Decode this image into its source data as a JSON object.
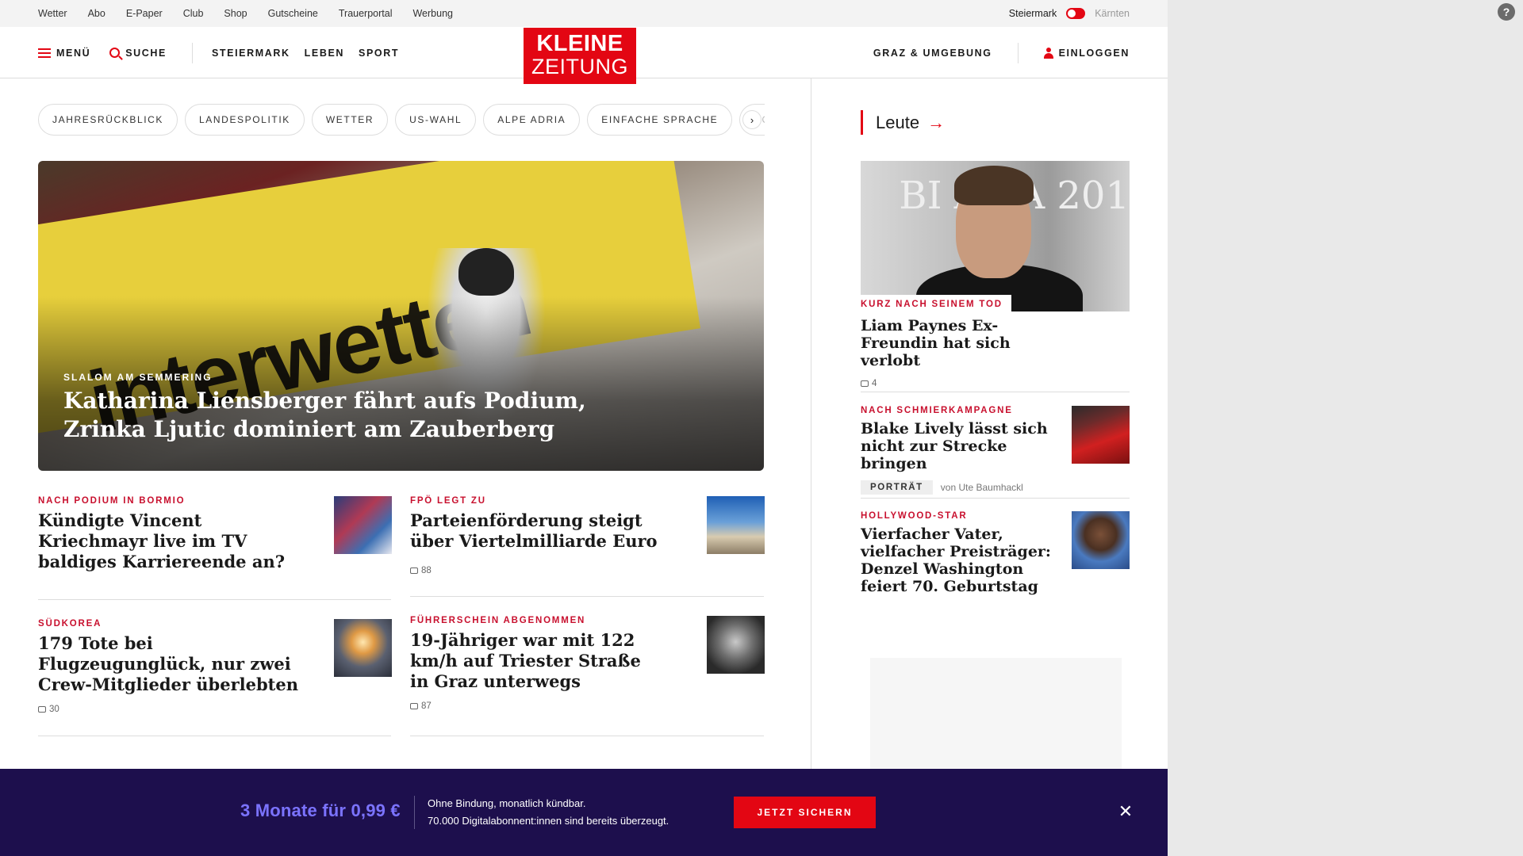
{
  "topbar": {
    "links": [
      "Wetter",
      "Abo",
      "E-Paper",
      "Club",
      "Shop",
      "Gutscheine",
      "Trauerportal",
      "Werbung"
    ],
    "region_active": "Steiermark",
    "region_inactive": "Kärnten"
  },
  "header": {
    "menu_label": "MENÜ",
    "search_label": "SUCHE",
    "nav": [
      "STEIERMARK",
      "LEBEN",
      "SPORT"
    ],
    "logo_line1": "KLEINE",
    "logo_line2": "ZEITUNG",
    "local_label": "GRAZ & UMGEBUNG",
    "login_label": "EINLOGGEN"
  },
  "chips": [
    "JAHRESRÜCKBLICK",
    "LANDESPOLITIK",
    "WETTER",
    "US-WAHL",
    "ALPE ADRIA",
    "EINFACHE SPRACHE",
    "DO"
  ],
  "hero": {
    "banner_text": "interwetten",
    "kicker": "SLALOM AM SEMMERING",
    "headline": "Katharina Liensberger fährt aufs Podium, Zrinka Ljutic dominiert am Zauberberg"
  },
  "articles": [
    {
      "kicker": "NACH PODIUM IN BORMIO",
      "title": "Kündigte Vincent Kriechmayr live im TV baldiges Karriereende an?",
      "comments": ""
    },
    {
      "kicker": "FPÖ LEGT ZU",
      "title": "Parteienförderung steigt über Viertelmilliarde Euro",
      "comments": "88"
    },
    {
      "kicker": "SÜDKOREA",
      "title": "179 Tote bei Flugzeugunglück, nur zwei Crew-Mitglieder überlebten",
      "comments": "30"
    },
    {
      "kicker": "FÜHRERSCHEIN ABGENOMMEN",
      "title": "19-Jähriger war mit 122 km/h auf Triester Straße in Graz unterwegs",
      "comments": "87"
    }
  ],
  "sidebar": {
    "section_title": "Leute",
    "arrow": "→",
    "image_text": "BI AWA 201",
    "items": [
      {
        "kicker": "KURZ NACH SEINEM TOD",
        "title": "Liam Paynes Ex-Freundin hat sich verlobt",
        "comments": "4"
      },
      {
        "kicker": "NACH SCHMIERKAMPAGNE",
        "title": "Blake Lively lässt sich nicht zur Strecke bringen",
        "tag": "PORTRÄT",
        "byline": "von Ute Baumhackl"
      },
      {
        "kicker": "HOLLYWOOD-STAR",
        "title": "Vierfacher Vater, vielfacher Preisträger: Denzel Washington feiert 70. Geburtstag"
      }
    ]
  },
  "promo": {
    "price": "3 Monate für 0,99 €",
    "line1": "Ohne Bindung, monatlich kündbar.",
    "line2": "70.000 Digitalabonnent:innen sind bereits überzeugt.",
    "cta": "JETZT SICHERN",
    "close": "✕"
  },
  "help_icon": "?",
  "colors": {
    "brand_red": "#e30613",
    "kicker_red": "#c8102e",
    "promo_bg": "#1d0f4d",
    "promo_price": "#7b73ff"
  }
}
